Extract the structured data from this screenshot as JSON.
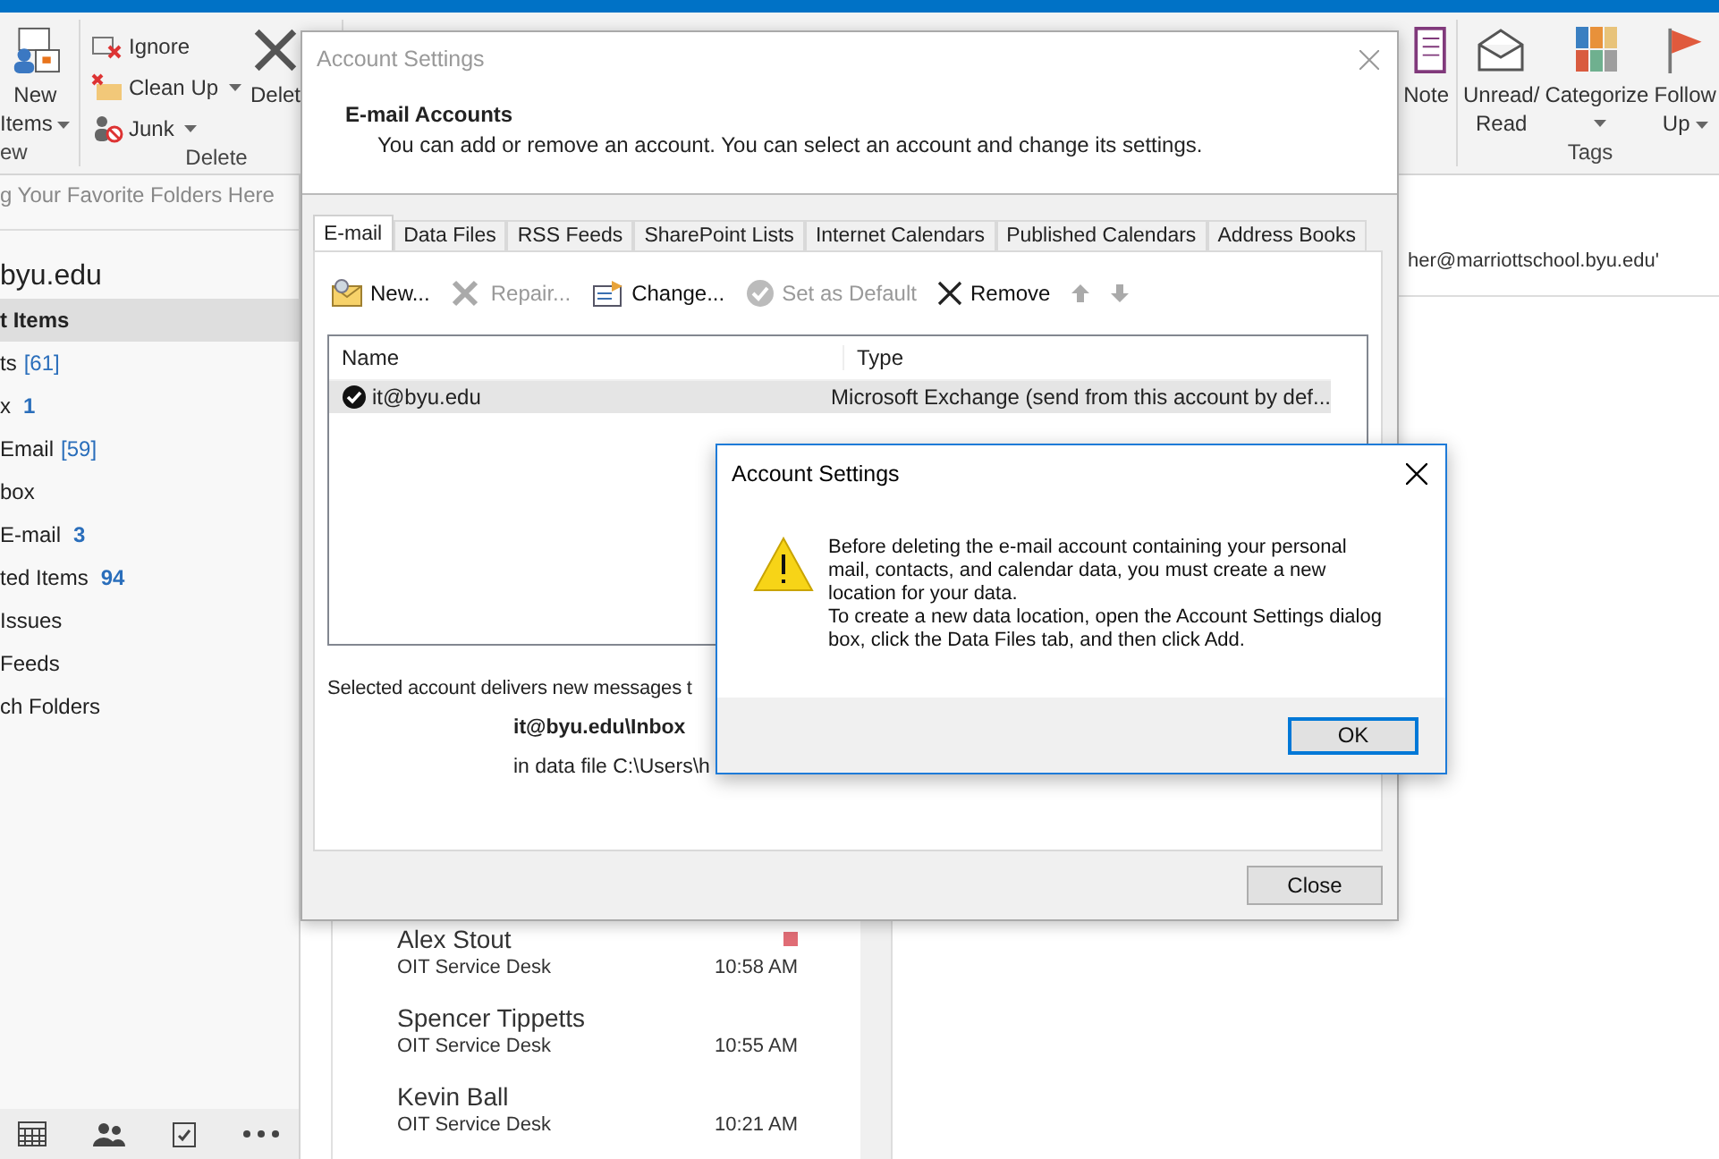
{
  "ribbon": {
    "groups": [
      {
        "label": "ew",
        "buttons": [
          {
            "lines": [
              "New",
              "Items"
            ],
            "dropdown": true
          }
        ]
      },
      {
        "label": "Delete",
        "buttons": [
          {
            "lines": [
              "Ignore"
            ]
          },
          {
            "lines": [
              "Clean Up"
            ],
            "dropdown": true
          },
          {
            "lines": [
              "Junk"
            ],
            "dropdown": true
          },
          {
            "lines": [
              "Delet"
            ]
          }
        ]
      },
      {
        "buttons": [
          {
            "lines": [
              "Note"
            ]
          }
        ]
      },
      {
        "label": "Tags",
        "buttons": [
          {
            "lines": [
              "Unread/",
              "Read"
            ]
          },
          {
            "lines": [
              "Categorize"
            ],
            "dropdown": true
          },
          {
            "lines": [
              "Follow",
              "Up"
            ],
            "dropdown": true
          }
        ]
      }
    ]
  },
  "folder_pane": {
    "favorites_hint": "g Your Favorite Folders Here",
    "account": "byu.edu",
    "folders": [
      {
        "name": "t Items",
        "selected": true
      },
      {
        "name": "ts",
        "count": "[61]",
        "count_bold": false,
        "selected": false
      },
      {
        "name": "x",
        "count": "1",
        "count_bold": true,
        "selected": false
      },
      {
        "name": "Email",
        "count": "[59]",
        "count_bold": false,
        "selected": false
      },
      {
        "name": "box",
        "selected": false
      },
      {
        "name": "E-mail",
        "count": "3",
        "count_bold": true,
        "selected": false
      },
      {
        "name": "ted Items",
        "count": "94",
        "count_bold": true,
        "selected": false
      },
      {
        "name": "Issues",
        "selected": false
      },
      {
        "name": "Feeds",
        "selected": false
      },
      {
        "name": "ch Folders",
        "selected": false
      }
    ]
  },
  "messages": [
    {
      "sender": "Alex Stout",
      "from": "OIT Service Desk",
      "time": "10:58 AM",
      "categorized": true
    },
    {
      "sender": "Spencer Tippetts",
      "from": "OIT Service Desk",
      "time": "10:55 AM"
    },
    {
      "sender": "Kevin Ball",
      "from": "OIT Service Desk",
      "time": "10:21 AM"
    }
  ],
  "reading_pane": {
    "header_text": "her@marriottschool.byu.edu'"
  },
  "account_dialog": {
    "title": "Account Settings",
    "active": false,
    "heading": "E-mail Accounts",
    "subtitle": "You can add or remove an account. You can select an account and change its settings.",
    "tabs": [
      {
        "label": "E-mail",
        "selected": true
      },
      {
        "label": "Data Files",
        "selected": false
      },
      {
        "label": "RSS Feeds",
        "selected": false
      },
      {
        "label": "SharePoint Lists",
        "selected": false
      },
      {
        "label": "Internet Calendars",
        "selected": false
      },
      {
        "label": "Published Calendars",
        "selected": false
      },
      {
        "label": "Address Books",
        "selected": false
      }
    ],
    "toolbar": [
      {
        "label": "New...",
        "disabled": false
      },
      {
        "label": "Repair...",
        "disabled": true
      },
      {
        "label": "Change...",
        "disabled": false
      },
      {
        "label": "Set as Default",
        "disabled": true
      },
      {
        "label": "Remove",
        "disabled": false
      }
    ],
    "move_up": {
      "disabled": true
    },
    "move_down": {
      "disabled": true
    },
    "columns": [
      "Name",
      "Type"
    ],
    "rows": [
      {
        "name": "it@byu.edu",
        "type": "Microsoft Exchange (send from this account by def...",
        "default": true,
        "selected": true
      }
    ],
    "delivery_label": "Selected account delivers new messages t",
    "delivery_folder": "it@byu.edu\\Inbox",
    "data_file": "in data file C:\\Users\\h",
    "close_button": "Close"
  },
  "message_box": {
    "title": "Account Settings",
    "active": true,
    "paragraphs": [
      "Before deleting the e-mail account containing your personal mail, contacts, and calendar data, you must create a new location for your data.",
      "To create a new data location, open the Account Settings dialog box, click the Data Files tab, and then click Add."
    ],
    "ok_button": "OK"
  }
}
